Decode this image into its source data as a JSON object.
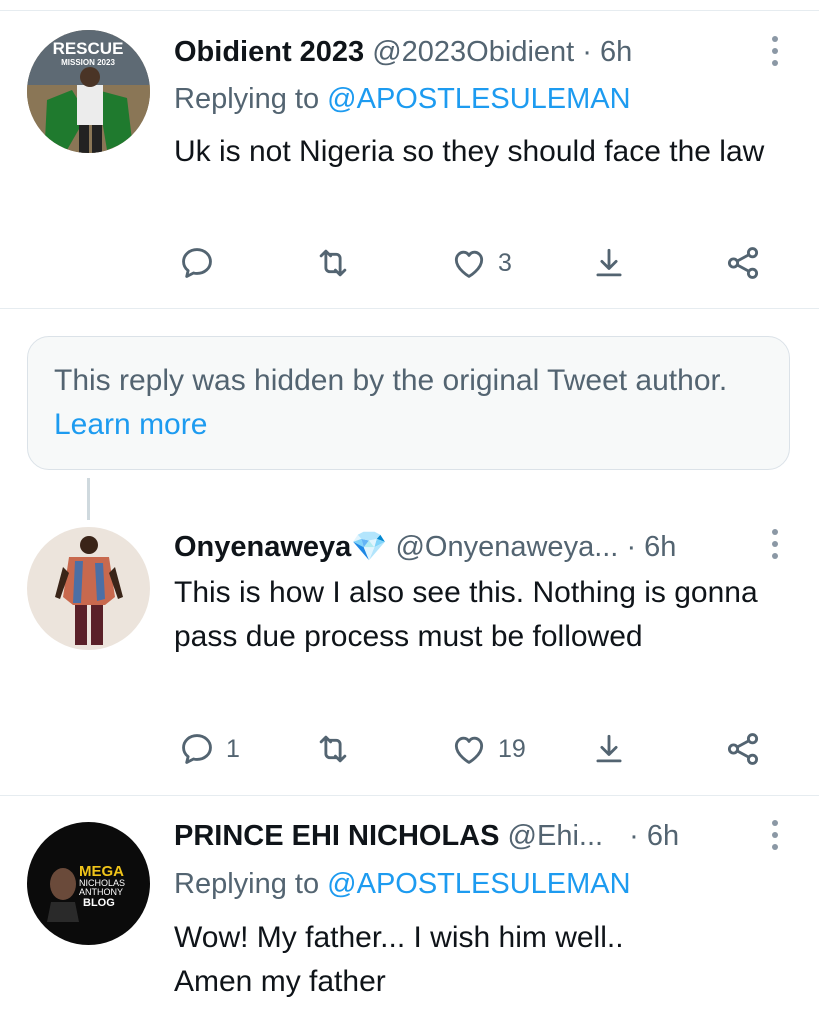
{
  "tweets": [
    {
      "name": "Obidient 2023",
      "handle": "@2023Obidient",
      "dot": "·",
      "time": "6h",
      "replying_prefix": "Replying to ",
      "replying_to": "@APOSTLESULEMAN",
      "text": "Uk is not Nigeria so they should face the law",
      "avatar_text": [
        "RESCUE",
        "MISSION 2023"
      ],
      "replies": "",
      "retweets": "",
      "likes": "3"
    },
    {
      "name": "Onyenaweya💎",
      "handle": "@Onyenaweya...",
      "dot": "·",
      "time": "6h",
      "text": "This is how I also see this. Nothing is gonna pass due process must be followed",
      "replies": "1",
      "retweets": "",
      "likes": "19"
    },
    {
      "name": "PRINCE EHI NICHOLAS",
      "handle": "@Ehi...",
      "dot": "·",
      "time": "6h",
      "replying_prefix": "Replying to ",
      "replying_to": "@APOSTLESULEMAN",
      "text": "Wow! My father... I wish him well.. Amen my father",
      "avatar_text": [
        "MEGA",
        "NICHOLAS",
        "ANTHONY",
        "BLOG"
      ]
    }
  ],
  "hidden_notice": {
    "text": "This reply was hidden by the original Tweet author. ",
    "link": "Learn more"
  },
  "colors": {
    "accent": "#1d9bf0",
    "secondary_text": "#536471",
    "divider": "#e6ecf0"
  },
  "icons": [
    "reply-icon",
    "retweet-icon",
    "like-icon",
    "bookmark-icon",
    "share-icon",
    "more-icon"
  ]
}
